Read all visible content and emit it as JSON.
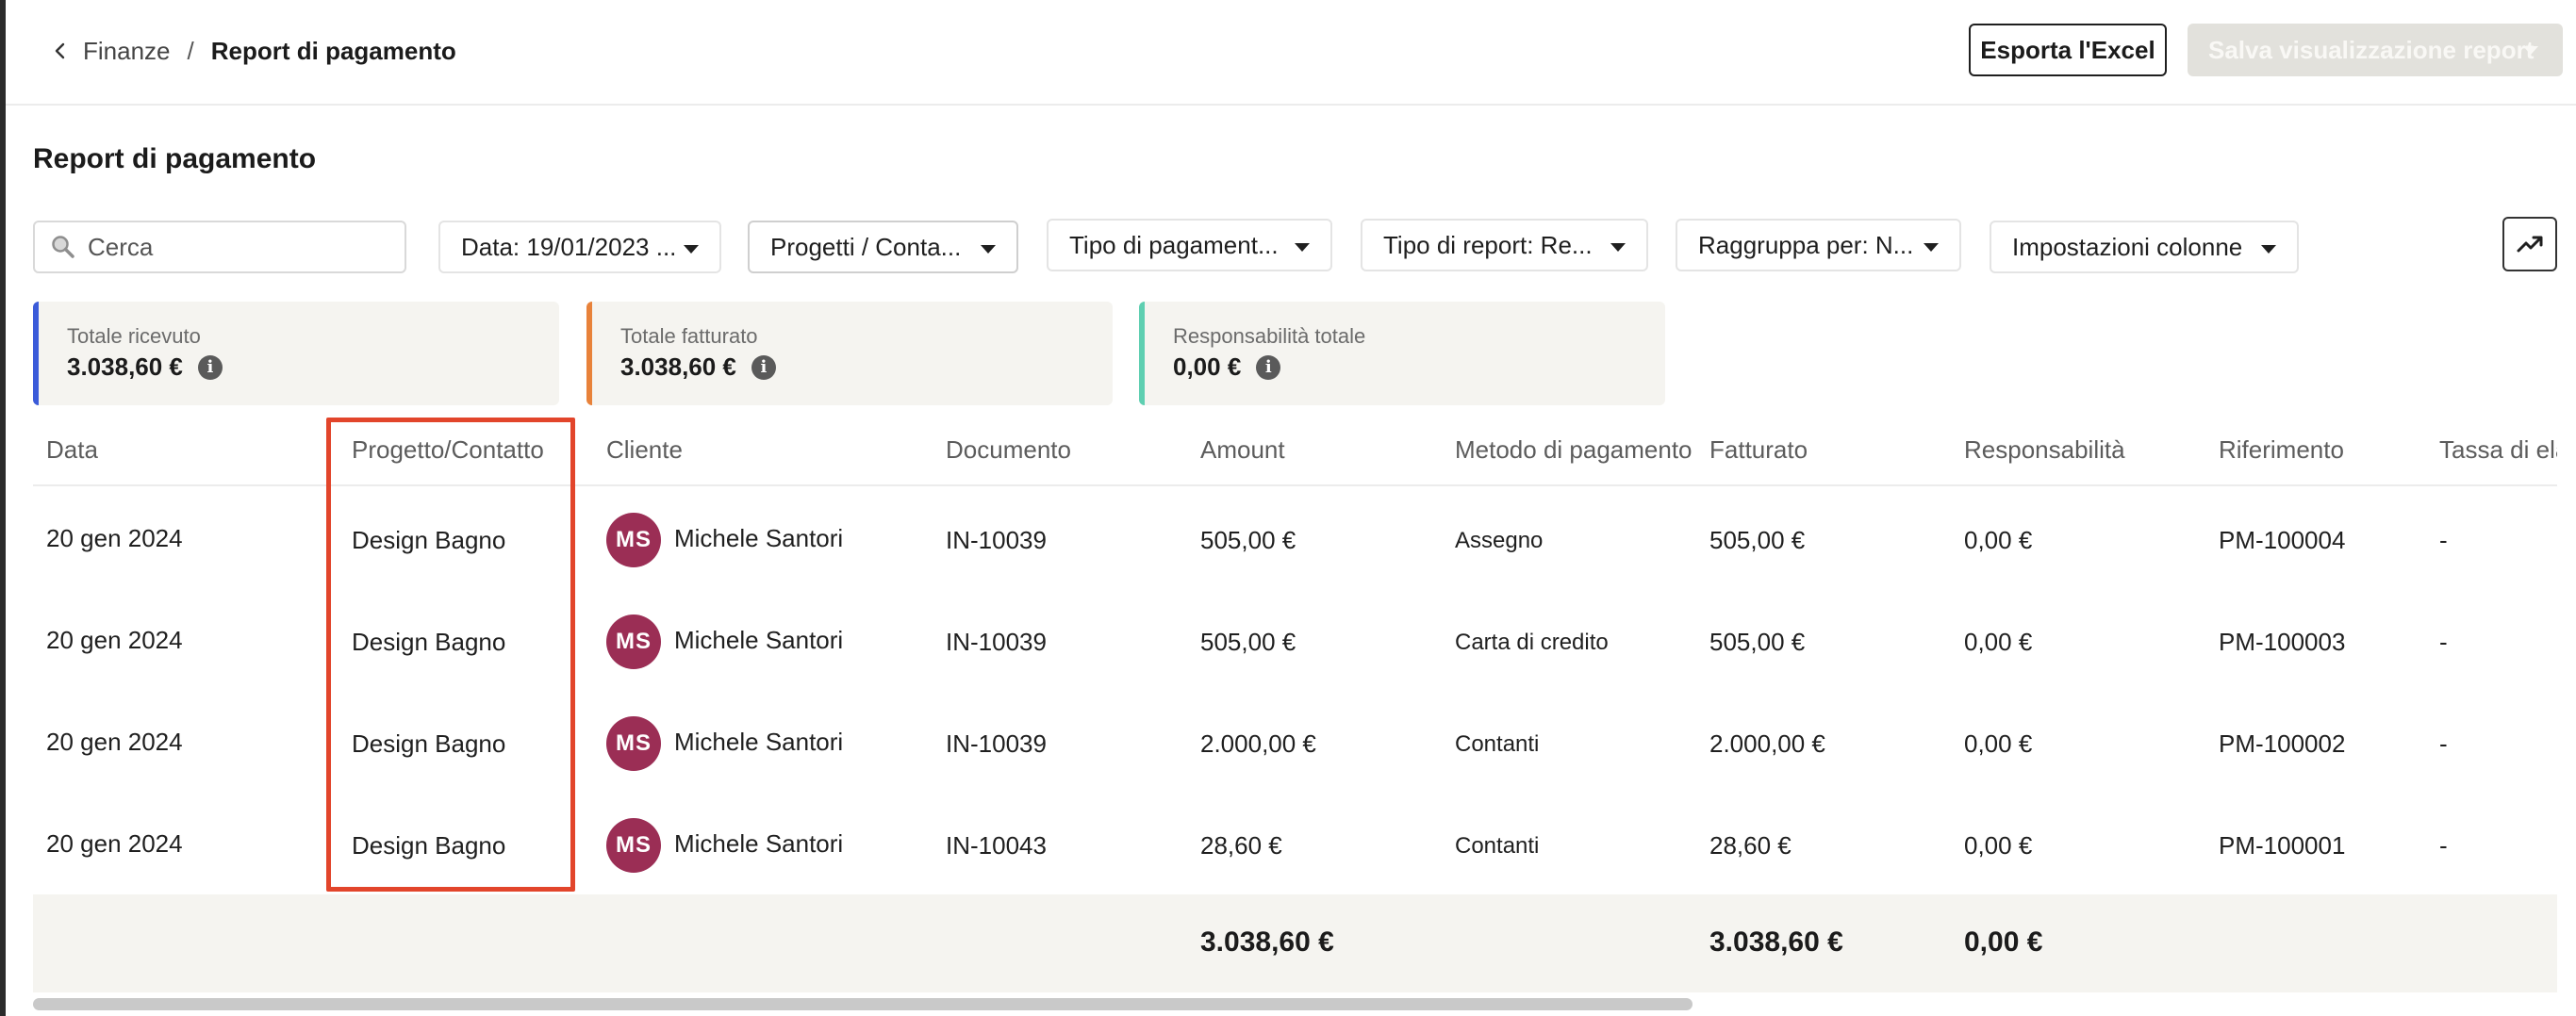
{
  "breadcrumb": {
    "parent": "Finanze",
    "separator": "/",
    "current": "Report di pagamento"
  },
  "header": {
    "export_label": "Esporta l'Excel",
    "save_label": "Salva visualizzazione report"
  },
  "page": {
    "title": "Report di pagamento"
  },
  "search": {
    "placeholder": "Cerca"
  },
  "filters": [
    {
      "label": "Data: 19/01/2023 ..."
    },
    {
      "label": "Progetti / Conta..."
    },
    {
      "label": "Tipo di pagament..."
    },
    {
      "label": "Tipo di report: Re..."
    },
    {
      "label": "Raggruppa per: N..."
    },
    {
      "label": "Impostazioni colonne"
    }
  ],
  "summary": [
    {
      "label": "Totale ricevuto",
      "value": "3.038,60 €",
      "color": "#3b5bd9"
    },
    {
      "label": "Totale fatturato",
      "value": "3.038,60 €",
      "color": "#e8823a"
    },
    {
      "label": "Responsabilità totale",
      "value": "0,00 €",
      "color": "#5ecfb1"
    }
  ],
  "table": {
    "columns": [
      "Data",
      "Progetto/Contatto",
      "Cliente",
      "Documento",
      "Amount",
      "Metodo di pagamento",
      "Fatturato",
      "Responsabilità",
      "Riferimento",
      "Tassa di ela"
    ],
    "rows": [
      {
        "date": "20 gen 2024",
        "project": "Design Bagno",
        "initials": "MS",
        "client": "Michele Santori",
        "document": "IN-10039",
        "amount": "505,00 €",
        "method": "Assegno",
        "invoiced": "505,00 €",
        "liability": "0,00 €",
        "reference": "PM-100004",
        "tax": "-"
      },
      {
        "date": "20 gen 2024",
        "project": "Design Bagno",
        "initials": "MS",
        "client": "Michele Santori",
        "document": "IN-10039",
        "amount": "505,00 €",
        "method": "Carta di credito",
        "invoiced": "505,00 €",
        "liability": "0,00 €",
        "reference": "PM-100003",
        "tax": "-"
      },
      {
        "date": "20 gen 2024",
        "project": "Design Bagno",
        "initials": "MS",
        "client": "Michele Santori",
        "document": "IN-10039",
        "amount": "2.000,00 €",
        "method": "Contanti",
        "invoiced": "2.000,00 €",
        "liability": "0,00 €",
        "reference": "PM-100002",
        "tax": "-"
      },
      {
        "date": "20 gen 2024",
        "project": "Design Bagno",
        "initials": "MS",
        "client": "Michele Santori",
        "document": "IN-10043",
        "amount": "28,60 €",
        "method": "Contanti",
        "invoiced": "28,60 €",
        "liability": "0,00 €",
        "reference": "PM-100001",
        "tax": "-"
      }
    ],
    "totals": {
      "amount": "3.038,60 €",
      "invoiced": "3.038,60 €",
      "liability": "0,00 €"
    }
  },
  "colors": {
    "avatar": "#9b2e55",
    "highlight": "#e2452b"
  }
}
